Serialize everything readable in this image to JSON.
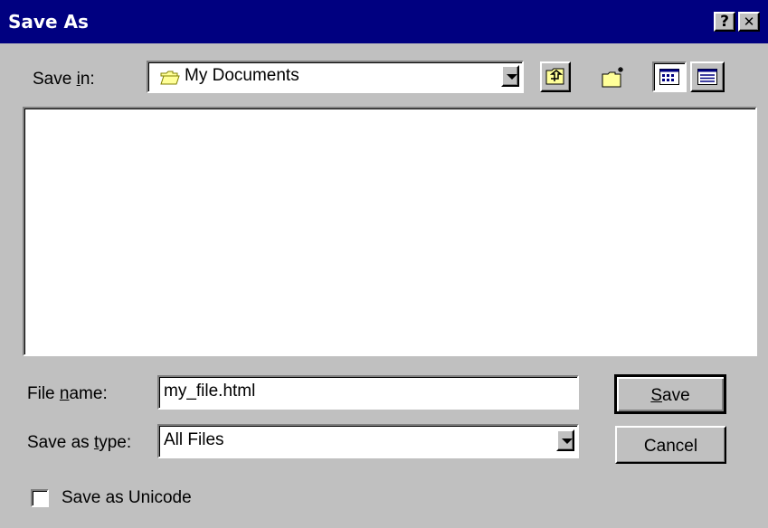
{
  "window": {
    "title": "Save As",
    "help_glyph": "?",
    "close_glyph": "✕"
  },
  "save_in": {
    "label_prefix": "Save ",
    "label_accel": "i",
    "label_suffix": "n:",
    "value": "My Documents"
  },
  "toolbar": {
    "icons": [
      "up-one-level-icon",
      "create-new-folder-icon",
      "list-view-icon",
      "details-view-icon"
    ]
  },
  "file_name": {
    "label_prefix": "File ",
    "label_accel": "n",
    "label_suffix": "ame:",
    "value": "my_file.html"
  },
  "save_as_type": {
    "label_prefix": "Save as ",
    "label_accel": "t",
    "label_suffix": "ype:",
    "value": "All Files"
  },
  "buttons": {
    "save_accel": "S",
    "save_rest": "ave",
    "cancel": "Cancel"
  },
  "unicode_option": {
    "label": "Save as Unicode",
    "checked": false
  },
  "colors": {
    "titlebar": "#000080",
    "face": "#c0c0c0",
    "folder": "#ffff99"
  }
}
